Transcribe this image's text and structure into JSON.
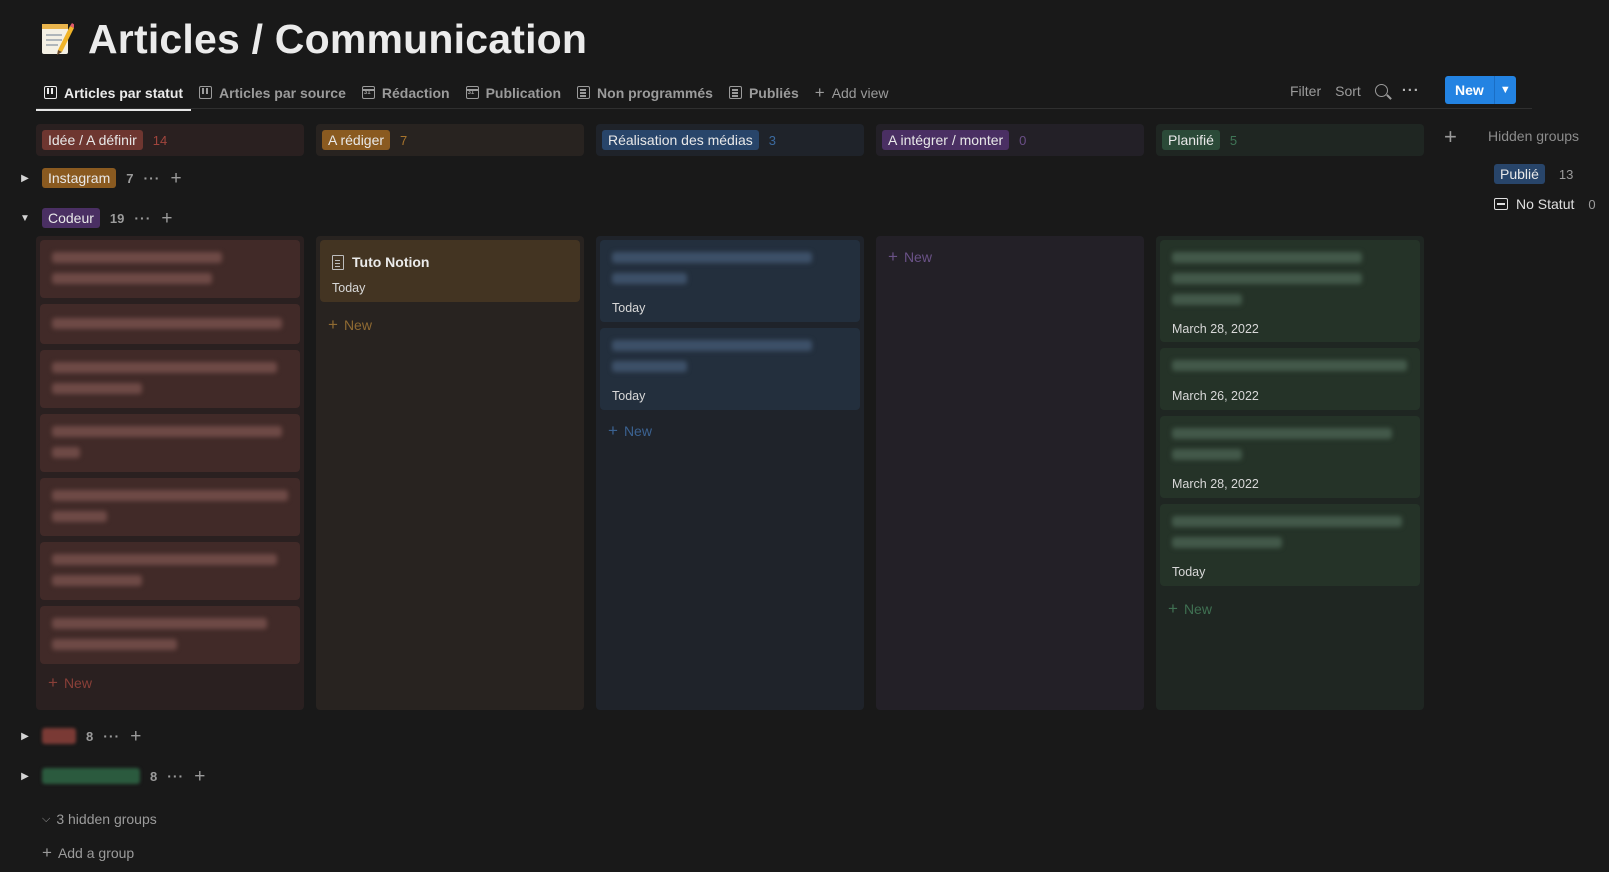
{
  "page": {
    "title": "Articles / Communication",
    "icon": "memo-icon"
  },
  "tabs": [
    {
      "label": "Articles par statut",
      "icon": "board-icon",
      "active": true
    },
    {
      "label": "Articles par source",
      "icon": "board-icon"
    },
    {
      "label": "Rédaction",
      "icon": "calendar-icon"
    },
    {
      "label": "Publication",
      "icon": "calendar-icon"
    },
    {
      "label": "Non programmés",
      "icon": "list-icon"
    },
    {
      "label": "Publiés",
      "icon": "list-icon"
    },
    {
      "label": "Add view",
      "icon": "plus-icon"
    }
  ],
  "toolbar": {
    "filter": "Filter",
    "sort": "Sort",
    "new_label": "New"
  },
  "columns": [
    {
      "label": "Idée / A définir",
      "count": "14",
      "pill_color": "#6e3630",
      "count_color": "#a1453d",
      "head_bg": "#2a2020"
    },
    {
      "label": "A rédiger",
      "count": "7",
      "pill_color": "#8a5a20",
      "count_color": "#a8742c",
      "head_bg": "#282320"
    },
    {
      "label": "Réalisation des médias",
      "count": "3",
      "pill_color": "#28456a",
      "count_color": "#3b6a9f",
      "head_bg": "#1f232a"
    },
    {
      "label": "A intégrer / monter",
      "count": "0",
      "pill_color": "#4a2f63",
      "count_color": "#6b4f88",
      "head_bg": "#232027"
    },
    {
      "label": "Planifié",
      "count": "5",
      "pill_color": "#2b4a38",
      "count_color": "#3f7556",
      "head_bg": "#1f2622"
    }
  ],
  "groups": [
    {
      "label": "Instagram",
      "count": "7",
      "pill_color": "#8a5a20"
    },
    {
      "label": "Codeur",
      "count": "19",
      "pill_color": "#4a2f63"
    },
    {
      "label": "",
      "count": "8",
      "pill_color": "#7a3a35"
    },
    {
      "label": "",
      "count": "8",
      "pill_color": "#2b5a3e"
    }
  ],
  "cards": {
    "redige": {
      "title": "Tuto Notion",
      "date": "Today"
    },
    "medias": [
      {
        "date": "Today"
      },
      {
        "date": "Today"
      }
    ],
    "planifie": [
      {
        "date": "March 28, 2022"
      },
      {
        "date": "March 26, 2022"
      },
      {
        "date": "March 28, 2022"
      },
      {
        "date": "Today"
      }
    ]
  },
  "add_new": "New",
  "hidden_groups": {
    "title": "Hidden groups",
    "items": [
      {
        "label": "Publié",
        "count": "13",
        "pill_color": "#28456a"
      },
      {
        "label": "No Statut",
        "count": "0"
      }
    ]
  },
  "footer": {
    "hidden_groups_label": "3 hidden groups",
    "add_group_label": "Add a group"
  }
}
